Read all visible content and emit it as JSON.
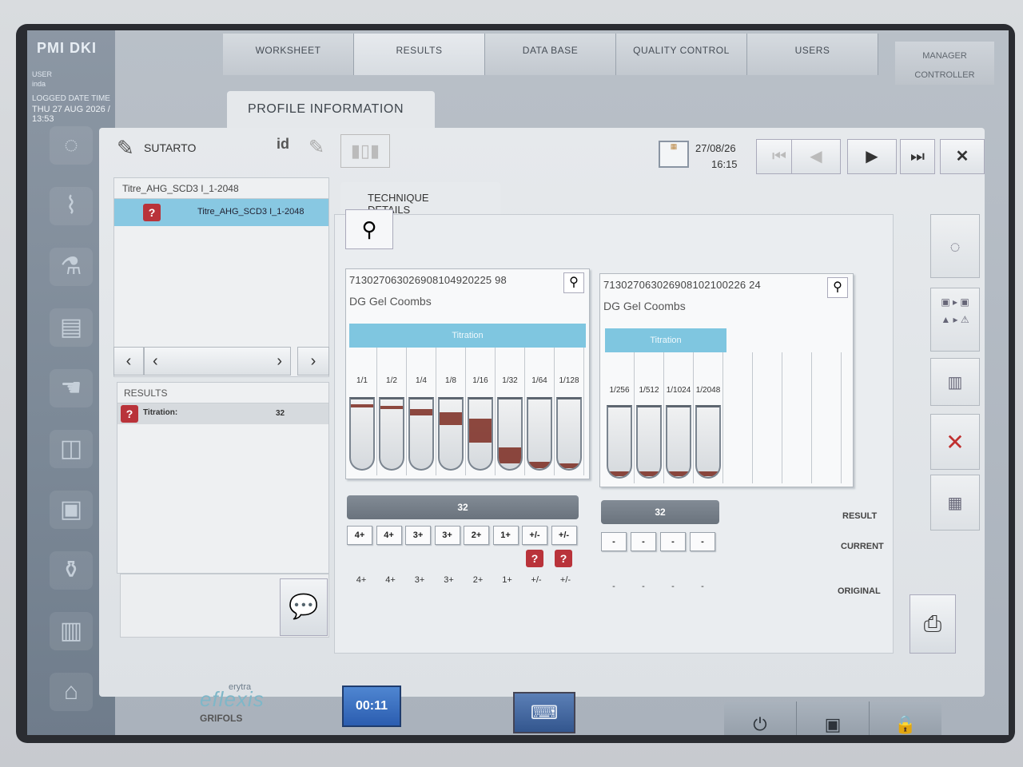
{
  "app": {
    "brand": "PMI DKI",
    "user_label": "USER",
    "user_value": "inda",
    "datetime_label": "LOGGED DATE TIME",
    "datetime_value": "THU 27 AUG 2026 / 13:53"
  },
  "nav": {
    "tabs": [
      {
        "label": "WORKSHEET"
      },
      {
        "label": "RESULTS"
      },
      {
        "label": "DATA BASE"
      },
      {
        "label": "QUALITY CONTROL"
      },
      {
        "label": "USERS"
      }
    ],
    "manager": "MANAGER",
    "controller": "CONTROLLER"
  },
  "profile": {
    "tab_title": "PROFILE INFORMATION",
    "patient_name": "SUTARTO",
    "id_icon_text": "id",
    "date": "27/08/26",
    "time": "16:15"
  },
  "sample_list": {
    "header": "Titre_AHG_SCD3 I_1-2048",
    "items": [
      {
        "label": "Titre_AHG_SCD3 I_1-2048",
        "status_icon": "?"
      }
    ]
  },
  "results": {
    "header": "RESULTS",
    "rows": [
      {
        "label": "Titration:",
        "value": "32",
        "status_icon": "?"
      }
    ]
  },
  "technique": {
    "tab_label": "TECHNIQUE DETAILS",
    "card1": {
      "code": "713027063026908104920225 98",
      "technique": "DG Gel Coombs",
      "band_label": "Titration",
      "dilutions": [
        "1/1",
        "1/2",
        "1/4",
        "1/8",
        "1/16",
        "1/32",
        "1/64",
        "1/128"
      ],
      "score": "32",
      "current": [
        "4+",
        "4+",
        "3+",
        "3+",
        "2+",
        "1+",
        "+/-",
        "+/-"
      ],
      "original": [
        "4+",
        "4+",
        "3+",
        "3+",
        "2+",
        "1+",
        "+/-",
        "+/-"
      ],
      "flag_icon": "?"
    },
    "card2": {
      "code": "713027063026908102100226 24",
      "technique": "DG Gel Coombs",
      "band_label": "Titration",
      "dilutions": [
        "1/256",
        "1/512",
        "1/1024",
        "1/2048"
      ],
      "score": "32",
      "current": [
        "-",
        "-",
        "-",
        "-"
      ],
      "original": [
        "-",
        "-",
        "-",
        "-"
      ]
    },
    "row_labels": {
      "result": "RESULT",
      "current": "CURRENT",
      "original": "ORIGINAL"
    }
  },
  "bottom": {
    "logo_sup": "erytra",
    "logo_main": "eflexis",
    "logo_sub": "GRIFOLS",
    "timer": "00:11"
  }
}
